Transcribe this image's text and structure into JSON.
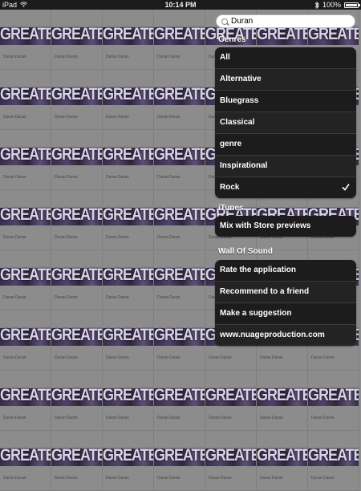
{
  "status_bar": {
    "device": "iPad",
    "time": "10:14 PM",
    "battery": "100%",
    "battery_level": 1.0
  },
  "background": {
    "art_text": "GREATEST",
    "caption": "Duran Duran"
  },
  "search": {
    "value": "Duran"
  },
  "genres": {
    "header": "Genres",
    "items": [
      {
        "label": "All",
        "selected": false
      },
      {
        "label": "Alternative",
        "selected": false
      },
      {
        "label": "Bluegrass",
        "selected": false
      },
      {
        "label": "Classical",
        "selected": false
      },
      {
        "label": "genre",
        "selected": false
      },
      {
        "label": "Inspirational",
        "selected": false
      },
      {
        "label": "Rock",
        "selected": true
      }
    ]
  },
  "itunes": {
    "header": "iTunes",
    "items": [
      {
        "label": "Mix with Store previews"
      }
    ]
  },
  "wall": {
    "header": "Wall Of Sound",
    "items": [
      {
        "label": "Rate the application"
      },
      {
        "label": "Recommend to a friend"
      },
      {
        "label": "Make a suggestion"
      },
      {
        "label": "www.nuageproduction.com"
      }
    ]
  },
  "colors": {
    "panel": "#1c1c1c",
    "background": "#8e8e8e",
    "art_purple": "#4a3a66"
  },
  "icons": {
    "search": "magnifier",
    "check": "checkmark",
    "wifi": "wifi",
    "bluetooth": "bluetooth",
    "battery": "battery"
  }
}
